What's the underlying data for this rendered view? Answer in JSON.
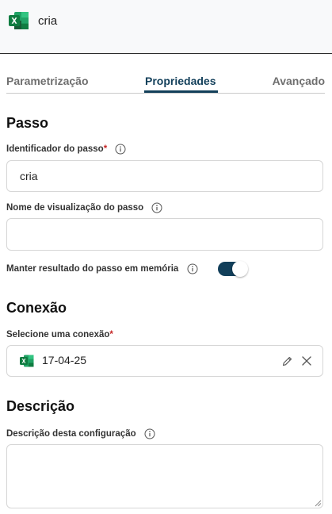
{
  "header": {
    "title": "cria",
    "app_icon": "excel-icon"
  },
  "tabs": [
    {
      "label": "Parametrização",
      "active": false
    },
    {
      "label": "Propriedades",
      "active": true
    },
    {
      "label": "Avançado",
      "active": false
    }
  ],
  "passo": {
    "title": "Passo",
    "identificador_label": "Identificador do passo",
    "identificador_required": "*",
    "identificador_value": "cria",
    "nome_label": "Nome de visualização do passo",
    "nome_value": "",
    "manter_label": "Manter resultado do passo em memória",
    "manter_enabled": true
  },
  "conexao": {
    "title": "Conexão",
    "select_label": "Selecione uma conexão",
    "select_required": "*",
    "selected_value": "17-04-25",
    "selected_icon": "excel-icon"
  },
  "descricao": {
    "title": "Descrição",
    "config_label": "Descrição desta configuração",
    "config_value": ""
  },
  "colors": {
    "accent": "#123f5a",
    "required": "#c62828",
    "excel_green": "#1d6f42"
  }
}
